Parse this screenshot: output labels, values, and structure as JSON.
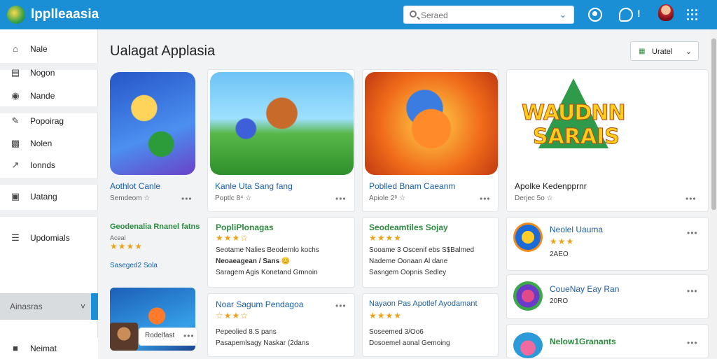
{
  "app": {
    "title": "lpplleaasia"
  },
  "search": {
    "placeholder": "Seraed"
  },
  "topbar": {
    "exclaim": "!"
  },
  "sidebar": {
    "items": [
      {
        "label": "Nale",
        "icon": "home-icon"
      },
      {
        "label": "Nogon",
        "icon": "inbox-icon"
      },
      {
        "label": "Nande",
        "icon": "camera-icon"
      },
      {
        "label": "Popoirag",
        "icon": "brush-icon"
      },
      {
        "label": "Nolen",
        "icon": "puzzle-icon"
      },
      {
        "label": "Ionnds",
        "icon": "trend-icon"
      },
      {
        "label": "Uatang",
        "icon": "media-icon"
      },
      {
        "label": "Updomials",
        "icon": "list-icon"
      }
    ],
    "selector": {
      "label": "Ainasras",
      "chevron": "˅"
    },
    "bottom": {
      "label": "Neimat",
      "icon": "folder-icon"
    }
  },
  "main": {
    "title": "Ualagat Applasia",
    "update_button": {
      "label": "Uratel",
      "icon": "sort-icon"
    }
  },
  "featured": [
    {
      "title": "Aothlot Canle",
      "sub": "Semdeom ☆",
      "more": "•••"
    },
    {
      "title": "Kanle Uta Sang fang",
      "sub": "Poptlc 8⁴ ☆",
      "more": "•••"
    },
    {
      "title": "Poblled Bnam Caeanm",
      "sub": "Apiole 2⁸ ☆",
      "more": "•••"
    },
    {
      "title": "Apolke Kedenpprnr",
      "sub": "Derjec 5o ☆",
      "more": "•••",
      "art_line1": "WAUDNN",
      "art_line2": "SARAIS"
    }
  ],
  "left_column": {
    "item1": {
      "title": "Geodenalia Rnanel fatns",
      "stars": "★★★★",
      "sub": "Aceal",
      "link": "Saseged2 Sola"
    },
    "item2": {
      "badge": "Rodelfast",
      "more": "•••"
    }
  },
  "grid_cards": [
    {
      "title": "PopliPlonagas",
      "stars": "★★★☆",
      "lines": [
        "Seotame Nalies Beodernlo kochs",
        "Neoaeagean / Sans 😊",
        "Saragem Agis Konetand Gmnoin"
      ],
      "more": ""
    },
    {
      "title": "Seodeamtiles Sojay",
      "stars": "★★★★",
      "lines": [
        "Sooame 3 Oscenif ebs S$Balmed",
        "Nademe Oonaan Al dane",
        "Sasngem Oopnis Sedley"
      ],
      "more": ""
    },
    {
      "title": "Noar Sagum Pendagoa",
      "stars": "☆★★☆",
      "lines": [
        "Pepeolied 8.S pans",
        "Pasapemlsagy Naskar (2dans"
      ],
      "more": "•••"
    },
    {
      "title": "Nayaon Pas Apotlef Ayodamant",
      "stars": "★★★★",
      "lines": [
        "Soseemed 3/Oo6",
        "Dosoemel aonal Gemoing"
      ],
      "more": "•••"
    }
  ],
  "right_column": [
    {
      "title": "Neolel Uauma",
      "stars": "★★★",
      "sub": "2AEO",
      "more": "•••"
    },
    {
      "title": "CoueNay Eay Ran",
      "stars": "",
      "sub": "20RO",
      "more": "•••"
    },
    {
      "title": "Nelow1Granants",
      "stars": "",
      "sub": "",
      "more": "•••"
    }
  ],
  "colors": {
    "topbar": "#1a8fd6",
    "link": "#1a5fa8",
    "green_title": "#2b8a3e",
    "star": "#e8a31b"
  }
}
